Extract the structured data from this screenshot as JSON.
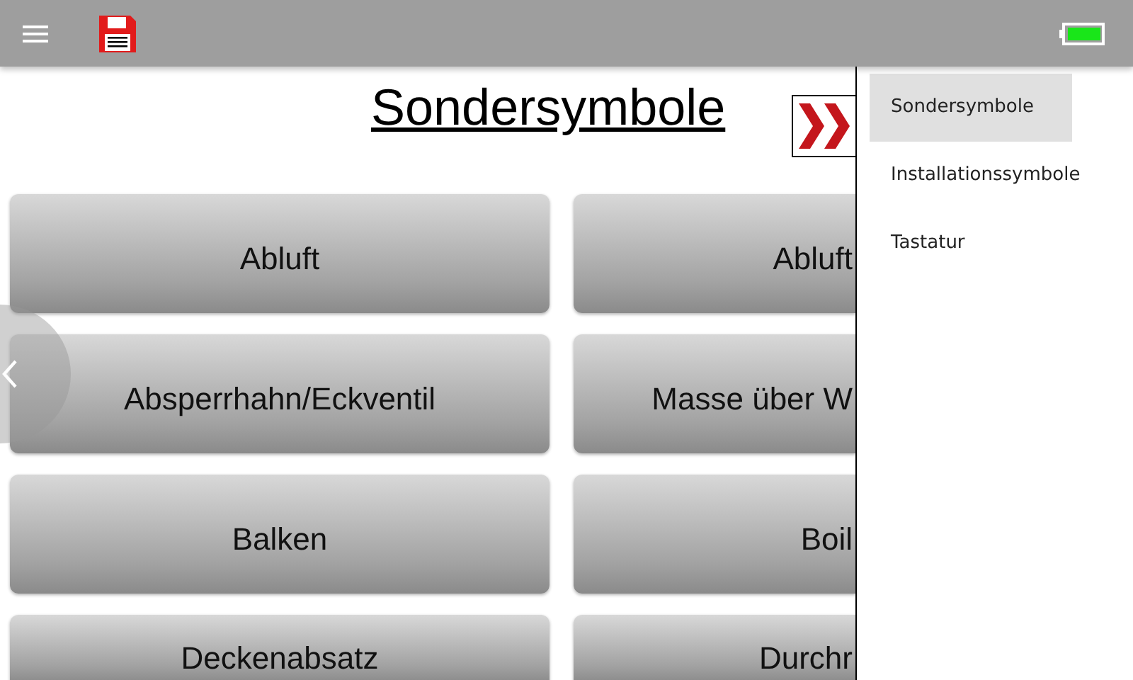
{
  "title": "Sondersymbole",
  "rows": [
    [
      "Abluft",
      "Abluft"
    ],
    [
      "Absperrhahn/Eckventil",
      "Masse über W"
    ],
    [
      "Balken",
      "Boil"
    ],
    [
      "Deckenabsatz",
      "Durchr"
    ]
  ],
  "drawer": {
    "items": [
      {
        "label": "Sondersymbole",
        "selected": true
      },
      {
        "label": "Installationssymbole",
        "selected": false
      },
      {
        "label": "Tastatur",
        "selected": false
      }
    ]
  }
}
